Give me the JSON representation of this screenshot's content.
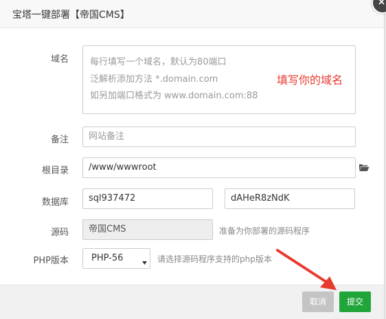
{
  "dialog": {
    "title": "宝塔一键部署【帝国CMS】"
  },
  "form": {
    "domain": {
      "label": "域名",
      "placeholder_lines": [
        "每行填写一个域名，默认为80端口",
        "泛解析添加方法 *.domain.com",
        "如另加端口格式为 www.domain.com:88"
      ],
      "annotation": "填写你的域名"
    },
    "remark": {
      "label": "备注",
      "placeholder": "网站备注"
    },
    "root_dir": {
      "label": "根目录",
      "value": "/www/wwwroot",
      "icon": "folder-open-icon"
    },
    "database": {
      "label": "数据库",
      "name": "sql937472",
      "password": "dAHeR8zNdK"
    },
    "source": {
      "label": "源码",
      "value": "帝国CMS",
      "help": "准备为你部署的源码程序"
    },
    "php_version": {
      "label": "PHP版本",
      "selected": "PHP-56",
      "help": "请选择源码程序支持的php版本"
    }
  },
  "footer": {
    "cancel_label": "取消",
    "submit_label": "提交"
  },
  "colors": {
    "submit": "#20a53a",
    "cancel": "#c4c4c4",
    "annotation": "#e8392f"
  }
}
